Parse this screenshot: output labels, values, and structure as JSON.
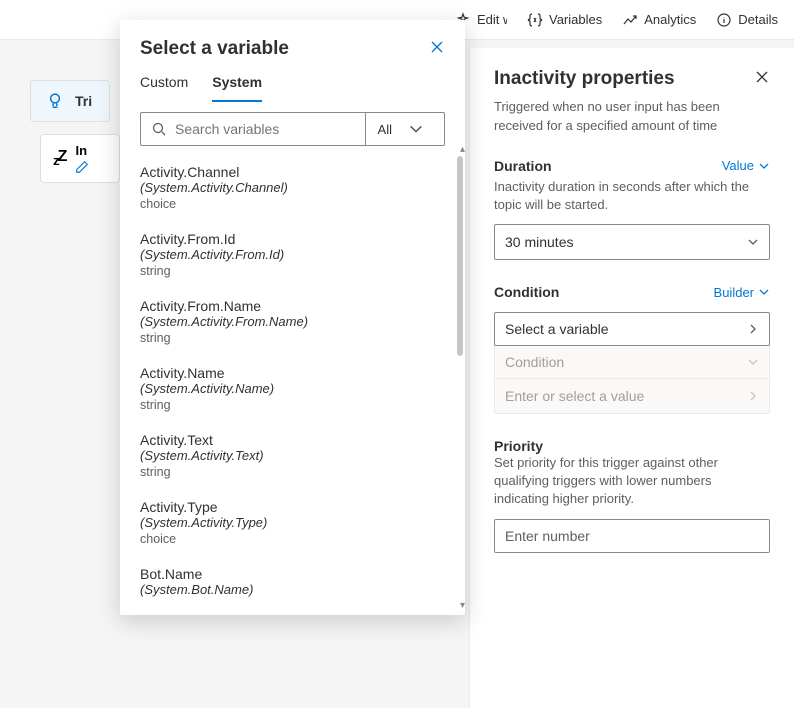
{
  "topbar": {
    "edit_label": "Edit with Copilot",
    "variables_label": "Variables",
    "analytics_label": "Analytics",
    "details_label": "Details"
  },
  "canvas": {
    "trigger_label": "Tri",
    "inactivity_label": "In"
  },
  "popover": {
    "title": "Select a variable",
    "tabs": {
      "custom": "Custom",
      "system": "System"
    },
    "search": {
      "placeholder": "Search variables",
      "filter_label": "All"
    },
    "variables": [
      {
        "name": "Activity.Channel",
        "path": "(System.Activity.Channel)",
        "type": "choice"
      },
      {
        "name": "Activity.From.Id",
        "path": "(System.Activity.From.Id)",
        "type": "string"
      },
      {
        "name": "Activity.From.Name",
        "path": "(System.Activity.From.Name)",
        "type": "string"
      },
      {
        "name": "Activity.Name",
        "path": "(System.Activity.Name)",
        "type": "string"
      },
      {
        "name": "Activity.Text",
        "path": "(System.Activity.Text)",
        "type": "string"
      },
      {
        "name": "Activity.Type",
        "path": "(System.Activity.Type)",
        "type": "choice"
      },
      {
        "name": "Bot.Name",
        "path": "(System.Bot.Name)",
        "type": ""
      }
    ]
  },
  "panel": {
    "title": "Inactivity properties",
    "description": "Triggered when no user input has been received for a specified amount of time",
    "duration": {
      "label": "Duration",
      "toggle": "Value",
      "description": "Inactivity duration in seconds after which the topic will be started.",
      "value": "30 minutes"
    },
    "condition": {
      "label": "Condition",
      "toggle": "Builder",
      "select_variable": "Select a variable",
      "condition_placeholder": "Condition",
      "value_placeholder": "Enter or select a value"
    },
    "priority": {
      "label": "Priority",
      "description": "Set priority for this trigger against other qualifying triggers with lower numbers indicating higher priority.",
      "placeholder": "Enter number"
    }
  }
}
